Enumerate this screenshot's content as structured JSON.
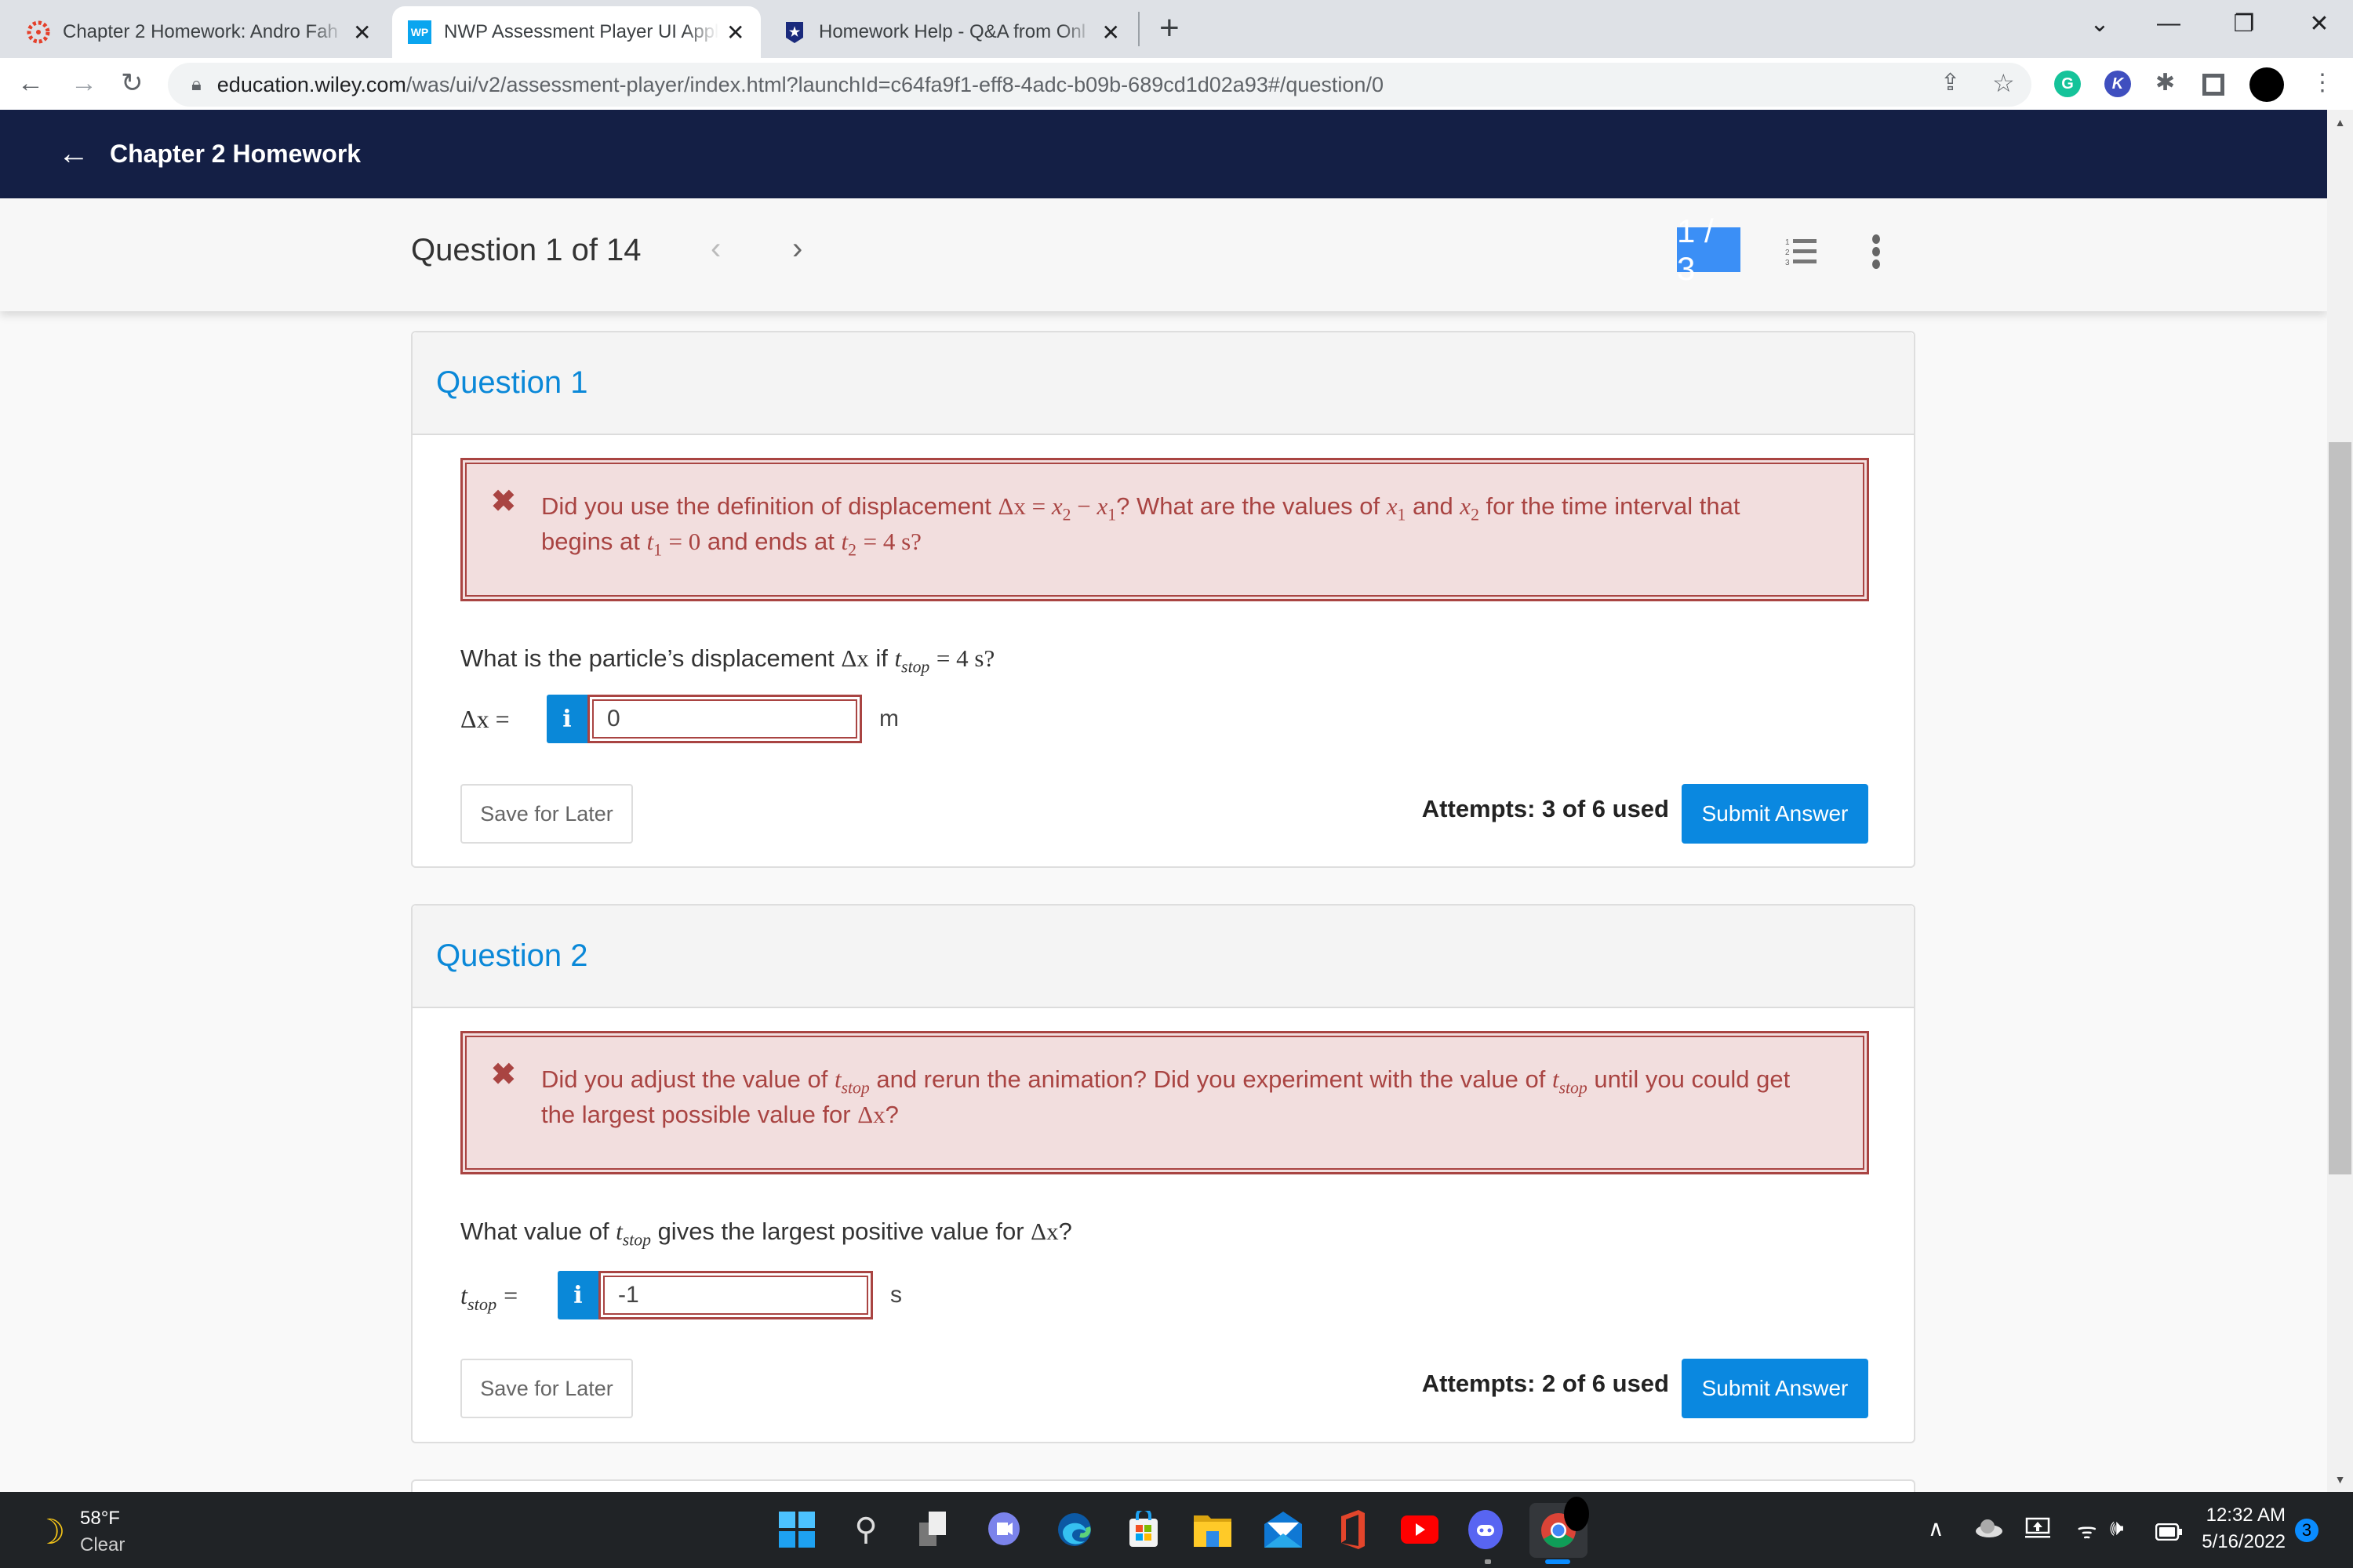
{
  "browser": {
    "tabs": [
      {
        "title": "Chapter 2 Homework: Andro Fah",
        "favicon": "canvas-icon",
        "active": false
      },
      {
        "title": "NWP Assessment Player UI Applic",
        "favicon": "wp-icon",
        "favicon_text": "WP",
        "active": true
      },
      {
        "title": "Homework Help - Q&A from Onl",
        "favicon": "star-shield-icon",
        "active": false
      }
    ],
    "url_host": "education.wiley.com",
    "url_path": "/was/ui/v2/assessment-player/index.html?launchId=c64fa9f1-eff8-4adc-b09b-689cd1d02a93#/question/0",
    "extensions": [
      {
        "name": "grammarly",
        "label": "G",
        "color": "#15c39a"
      },
      {
        "name": "kami",
        "label": "K",
        "color": "#3f4fbf"
      }
    ]
  },
  "header": {
    "back_label": "Chapter 2 Homework"
  },
  "question_nav": {
    "label": "Question 1 of 14",
    "page_indicator": "1 / 3"
  },
  "questions": [
    {
      "title": "Question 1",
      "feedback": {
        "line1_a": "Did you use the definition of displacement ",
        "line1_b": "? What are the values of ",
        "line1_c": " and ",
        "line1_d": " for the time interval that",
        "line2_a": "begins at ",
        "line2_b": " and ends at ",
        "eq_disp": "Δx = x₂ − x₁",
        "t1_eq": "= 0",
        "t2_eq": "= 4 s?"
      },
      "prompt_a": "What is the particle’s displacement ",
      "prompt_b": " if ",
      "prompt_c": "= 4 s?",
      "answer_label": "Δx =",
      "answer_value": "0",
      "unit": "m",
      "save_label": "Save for Later",
      "attempts": "Attempts: 3 of 6 used",
      "submit_label": "Submit Answer"
    },
    {
      "title": "Question 2",
      "feedback": {
        "line1_a": "Did you adjust the value of ",
        "line1_b": " and rerun the animation? Did you experiment with the value of ",
        "line1_c": " until you could get",
        "line2_a": "the largest possible value for ",
        "line2_b": "?"
      },
      "prompt_a": "What value of ",
      "prompt_b": " gives the largest positive value for ",
      "prompt_c": "?",
      "answer_label_var": "t",
      "answer_label_sub": "stop",
      "answer_value": "-1",
      "unit": "s",
      "save_label": "Save for Later",
      "attempts": "Attempts: 2 of 6 used",
      "submit_label": "Submit Answer"
    }
  ],
  "math": {
    "dx": "Δx",
    "t": "t",
    "stop": "stop",
    "x": "x",
    "one": "1",
    "two": "2",
    "eq": "=",
    "minus": "−"
  },
  "taskbar": {
    "weather_temp": "58°F",
    "weather_cond": "Clear",
    "time": "12:32 AM",
    "date": "5/16/2022",
    "notification_count": "3",
    "apps": [
      "start-icon",
      "search-icon",
      "task-view-icon",
      "teams-chat-icon",
      "edge-icon",
      "store-icon",
      "file-explorer-icon",
      "mail-icon",
      "office-icon",
      "youtube-icon",
      "discord-icon",
      "chrome-icon"
    ]
  }
}
